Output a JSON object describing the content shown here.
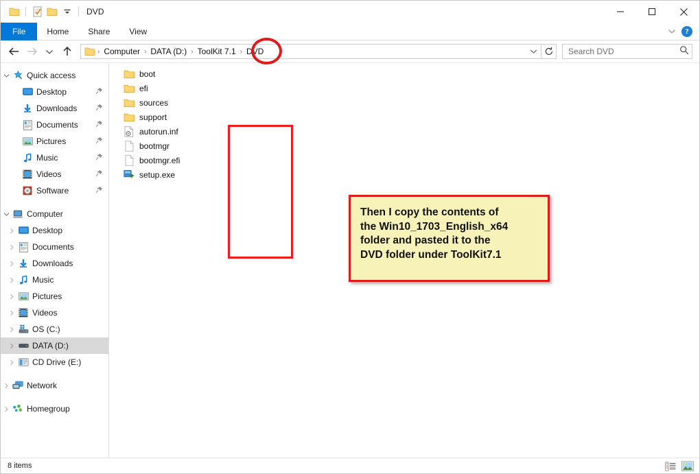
{
  "window": {
    "title": "DVD",
    "quick_access_toolbar": [
      {
        "name": "folder-icon",
        "label": "Folder"
      },
      {
        "name": "properties-icon",
        "label": "Properties"
      },
      {
        "name": "new-folder-icon",
        "label": "New folder"
      },
      {
        "name": "customize-qat-icon",
        "label": "Customize Quick Access Toolbar"
      }
    ],
    "controls": {
      "minimize": "Minimize",
      "maximize": "Maximize",
      "close": "Close"
    }
  },
  "ribbon": {
    "tabs": [
      {
        "label": "File",
        "active": true
      },
      {
        "label": "Home",
        "active": false
      },
      {
        "label": "Share",
        "active": false
      },
      {
        "label": "View",
        "active": false
      }
    ],
    "collapse_label": "Minimize the Ribbon",
    "help_label": "?"
  },
  "addressbar": {
    "back_label": "Back",
    "forward_label": "Forward",
    "recent_label": "Recent locations",
    "up_label": "Up",
    "crumbs": [
      "Computer",
      "DATA (D:)",
      "ToolKit 7.1",
      "DVD"
    ],
    "separator": "›",
    "dropdown_label": "Previous locations",
    "refresh_label": "Refresh",
    "highlighted_crumb": "DVD"
  },
  "search": {
    "placeholder": "Search DVD",
    "icon": "search-icon"
  },
  "navpane": {
    "sections": [
      {
        "name": "quick-access",
        "header": {
          "label": "Quick access",
          "icon": "star-pin-icon",
          "expanded": true
        },
        "items": [
          {
            "label": "Desktop",
            "icon": "desktop-icon",
            "pinned": true
          },
          {
            "label": "Downloads",
            "icon": "downloads-icon",
            "pinned": true
          },
          {
            "label": "Documents",
            "icon": "documents-icon",
            "pinned": true
          },
          {
            "label": "Pictures",
            "icon": "pictures-icon",
            "pinned": true
          },
          {
            "label": "Music",
            "icon": "music-icon",
            "pinned": true
          },
          {
            "label": "Videos",
            "icon": "videos-icon",
            "pinned": true
          },
          {
            "label": "Software",
            "icon": "disc-icon",
            "pinned": true
          }
        ]
      },
      {
        "name": "computer",
        "header": {
          "label": "Computer",
          "icon": "computer-icon",
          "expanded": true
        },
        "items": [
          {
            "label": "Desktop",
            "icon": "desktop-icon",
            "selected": false
          },
          {
            "label": "Documents",
            "icon": "documents-icon",
            "selected": false
          },
          {
            "label": "Downloads",
            "icon": "downloads-icon",
            "selected": false
          },
          {
            "label": "Music",
            "icon": "music-icon",
            "selected": false
          },
          {
            "label": "Pictures",
            "icon": "pictures-icon",
            "selected": false
          },
          {
            "label": "Videos",
            "icon": "videos-icon",
            "selected": false
          },
          {
            "label": "OS (C:)",
            "icon": "harddrive-os-icon",
            "selected": false
          },
          {
            "label": "DATA (D:)",
            "icon": "harddrive-icon",
            "selected": true
          },
          {
            "label": "CD Drive (E:)",
            "icon": "cddrive-icon",
            "selected": false
          }
        ]
      },
      {
        "name": "network",
        "header": {
          "label": "Network",
          "icon": "network-icon",
          "expanded": false
        },
        "items": []
      },
      {
        "name": "homegroup",
        "header": {
          "label": "Homegroup",
          "icon": "homegroup-icon",
          "expanded": false
        },
        "items": []
      }
    ]
  },
  "filelist": {
    "items": [
      {
        "name": "boot",
        "icon": "folder-icon",
        "type": "folder"
      },
      {
        "name": "efi",
        "icon": "folder-icon",
        "type": "folder"
      },
      {
        "name": "sources",
        "icon": "folder-icon",
        "type": "folder"
      },
      {
        "name": "support",
        "icon": "folder-icon",
        "type": "folder"
      },
      {
        "name": "autorun.inf",
        "icon": "inf-gear-icon",
        "type": "file"
      },
      {
        "name": "bootmgr",
        "icon": "blank-file-icon",
        "type": "file"
      },
      {
        "name": "bootmgr.efi",
        "icon": "blank-file-icon",
        "type": "file"
      },
      {
        "name": "setup.exe",
        "icon": "application-icon",
        "type": "file"
      }
    ]
  },
  "annotations": {
    "note": {
      "lines": [
        "Then I copy the contents of",
        "the Win10_1703_English_x64",
        "folder and pasted it to the",
        "DVD folder under ToolKit7.1"
      ],
      "background": "#f7f2b7",
      "border_color": "#e01b1b"
    },
    "rect_highlight": {
      "target": "file-list",
      "color": "#ee1c1c"
    },
    "ellipse_highlight": {
      "target": "DVD",
      "color": "#e01b1b"
    }
  },
  "statusbar": {
    "item_count": "8 items",
    "views": [
      {
        "name": "details-view-button",
        "label": "Details view",
        "active": false
      },
      {
        "name": "large-icons-view-button",
        "label": "Large icons view",
        "active": true
      }
    ]
  },
  "colors": {
    "accent": "#0078d7",
    "annotation_red": "#e01b1b",
    "note_yellow": "#f7f2b7",
    "folder_yellow": "#fcd771",
    "selection_gray": "#d8d8d8"
  }
}
